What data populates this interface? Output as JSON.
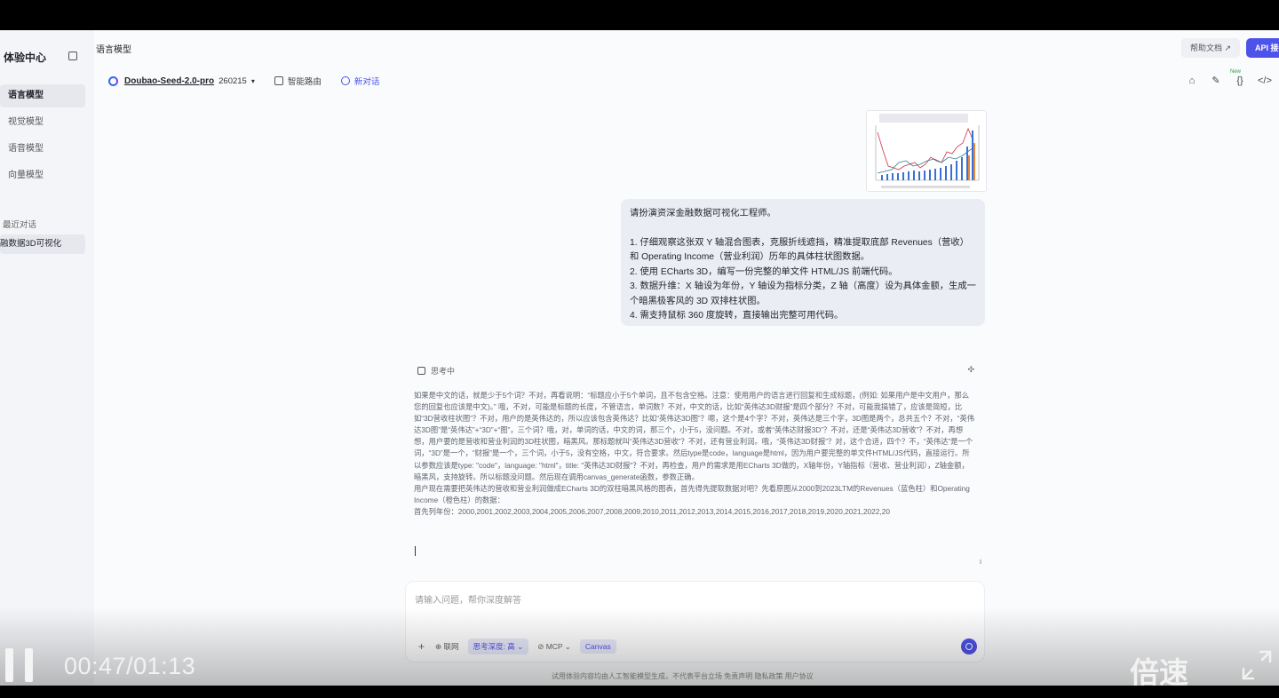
{
  "sidebar": {
    "brand": "体验中心",
    "items": [
      {
        "label": "语言模型",
        "active": true
      },
      {
        "label": "视觉模型",
        "active": false
      },
      {
        "label": "语音模型",
        "active": false
      },
      {
        "label": "向量模型",
        "active": false
      }
    ],
    "recent_title": "最近对话",
    "recent_item": "融数据3D可视化"
  },
  "header": {
    "page_title": "语言模型",
    "help_label": "帮助文档 ↗",
    "api_label": "API 接"
  },
  "toolbar": {
    "model_name": "Doubao-Seed-2.0-pro",
    "model_version": "260215",
    "route_label": "智能路由",
    "new_chat_label": "新对话",
    "new_badge": "New"
  },
  "user_message": {
    "intro": "请扮演资深金融数据可视化工程师。",
    "steps": [
      "1. 仔细观察这张双 Y 轴混合图表，克服折线遮挡，精准提取底部 Revenues（营收）和 Operating Income（营业利润）历年的具体柱状图数据。",
      "2. 使用 ECharts 3D，编写一份完整的单文件 HTML/JS 前端代码。",
      "3. 数据升维：X 轴设为年份，Y 轴设为指标分类，Z 轴（高度）设为具体金额，生成一个暗黑极客风的 3D 双排柱状图。",
      "4. 需支持鼠标 360 度旋转，直接输出完整可用代码。"
    ]
  },
  "thinking": {
    "status": "思考中",
    "paragraph1": "如果是中文的话，就是少于5个词？不对，再看说明：“标题应小于5个单词，且不包含空格。注意：使用用户的语言进行回复和生成标题，(例如: 如果用户是中文用户，那么您的回复也应该是中文)。” 哦，不对，可能是标题的长度，不管语言，单词数？不对，中文的话，比如“英伟达3D财报”是四个部分？不对，可能我搞错了，应该是简短，比如“3D营收柱状图”？不对，用户的是英伟达的，所以应该包含英伟达？比如“英伟达3D图”？嗯，这个是4个字？不对，英伟达是三个字，3D图是两个，总共五个？不对，“英伟达3D图”是“英伟达”+“3D”+“图”，三个词？哦，对，单词的话，中文的词，那三个，小于5，没问题。不对，或者“英伟达财报3D”？不对，还是“英伟达3D营收”？不对，再想想，用户要的是营收和营业利润的3D柱状图，暗黑风。那标题就叫“英伟达3D营收”？不对，还有营业利润。哦，“英伟达3D财报”？对，这个合适，四个？不，“英伟达”是一个词，“3D”是一个，“财报”是一个，三个词，小于5，没有空格，中文，符合要求。然后type是code，language是html，因为用户要完整的单文件HTML/JS代码，直接运行。所以参数应该是type: \"code\"，language: \"html\"，title: \"英伟达3D财报\"？不对，再检查，用户的需求是用ECharts 3D做的，X轴年份，Y轴指标（营收、营业利润），Z轴金额，暗黑风，支持旋转。所以标题没问题。然后现在调用canvas_generate函数，参数正确。",
    "paragraph2": "用户现在需要把英伟达的营收和营业利润做成ECharts 3D的双柱暗黑风格的图表，首先得先提取数据对吧？先看原图从2000到2023LTM的Revenues（蓝色柱）和Operating Income（橙色柱）的数据：",
    "paragraph3": "首先列年份：2000,2001,2002,2003,2004,2005,2006,2007,2008,2009,2010,2011,2012,2013,2014,2015,2016,2017,2018,2019,2020,2021,2022,20"
  },
  "input": {
    "placeholder": "请输入问题，帮你深度解答",
    "tools": {
      "plus": "+",
      "search": "⊕ 联网",
      "depth": "思考深度: 高 ⌄",
      "mcp": "⊘ MCP ⌄",
      "canvas": "Canvas"
    }
  },
  "footer": "试用体验内容均由人工智能模型生成，不代表平台立场    免责声明    隐私政策    用户协议",
  "video": {
    "time": "00:47/01:13",
    "speed_label": "倍速"
  },
  "colors": {
    "accent": "#4d53e8",
    "bubble_bg": "#ebedf4"
  }
}
